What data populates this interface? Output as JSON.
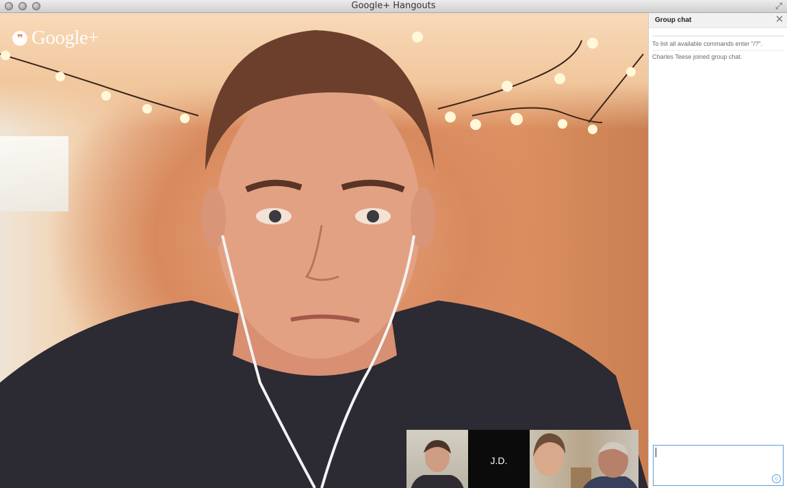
{
  "window": {
    "title": "Google+ Hangouts"
  },
  "video": {
    "brand_logo_text": "Google+"
  },
  "filmstrip": {
    "tiles": [
      {
        "label": ""
      },
      {
        "label": "J.D."
      },
      {
        "label": ""
      }
    ]
  },
  "sidebar": {
    "title": "Group chat",
    "messages": [
      "To list all available commands enter \"/?\".",
      "Charles Teese joined group chat."
    ],
    "input_value": ""
  },
  "colors": {
    "input_border": "#5b9bd5"
  }
}
